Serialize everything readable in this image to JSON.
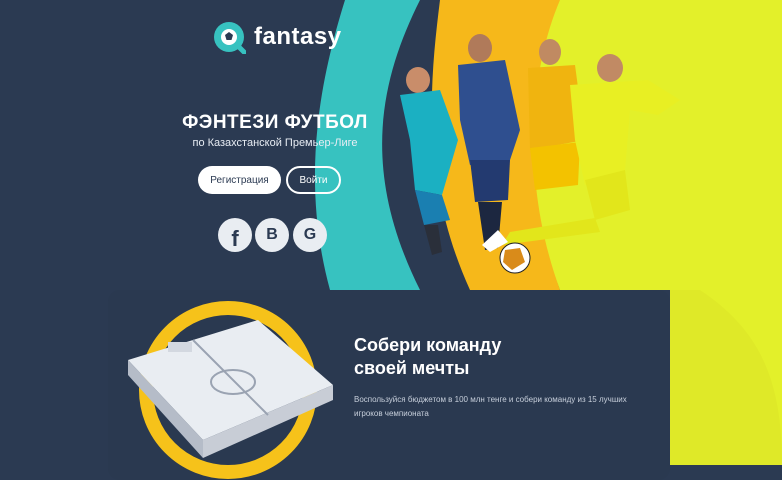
{
  "logo": {
    "text": "fantasy"
  },
  "hero": {
    "title": "ФЭНТЕЗИ ФУТБОЛ",
    "subtitle": "по Казахстанской Премьер-Лиге"
  },
  "buttons": {
    "register": "Регистрация",
    "login": "Войти"
  },
  "social": {
    "facebook": "f",
    "vk": "В",
    "google": "G"
  },
  "card": {
    "title_line1": "Собери команду",
    "title_line2": "своей мечты",
    "text": "Воспользуйся бюджетом в 100 млн тенге и собери команду из 15 лучших игроков чемпионата"
  },
  "colors": {
    "navy": "#2b3a52",
    "teal": "#37c2c0",
    "yellow": "#f6c21a",
    "lime": "#e3f02a"
  }
}
